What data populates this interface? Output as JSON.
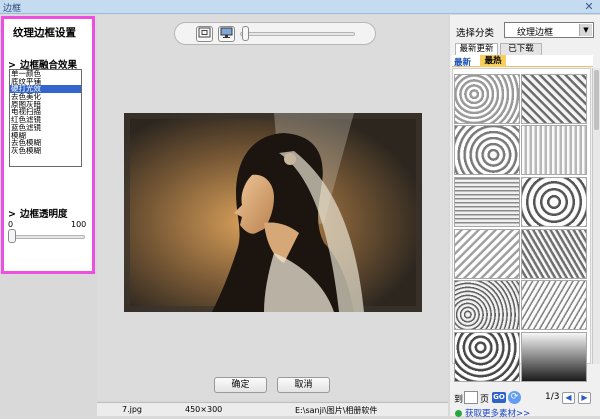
{
  "window": {
    "title": "边框",
    "close_glyph": "✕"
  },
  "left_panel": {
    "title": "纹理边框设置",
    "blend_section": {
      "title": "边框融合效果",
      "options": [
        "单一颜色",
        "底纹平铺",
        "硬打光效",
        "去色美化",
        "原图灰暗",
        "电视扫描",
        "红色滤镜",
        "蓝色滤镜",
        "模糊",
        "去色模糊",
        "灰色模糊"
      ],
      "selected_index": 2
    },
    "transparency_section": {
      "title": "边框透明度",
      "min_label": "0",
      "max_label": "100",
      "value": 0
    }
  },
  "preview": {
    "toolbar": {
      "fit_icon": "fit-to-window-icon",
      "actual_size_icon": "monitor-actual-size-icon",
      "zoom_level": 0
    },
    "confirm_label": "确定",
    "cancel_label": "取消",
    "status": {
      "filename": "7.jpg",
      "dimensions": "450×300",
      "path": "E:\\sanji\\图片\\相册软件"
    }
  },
  "right_panel": {
    "category_label": "选择分类",
    "category_value": "纹理边框",
    "tabs": [
      "最新更新",
      "已下载"
    ],
    "subtabs": [
      "最新",
      "最热"
    ],
    "active_subtab": 1,
    "thumbnails_count": 12,
    "pager": {
      "goto_label": "到",
      "page_label": "页",
      "go_label": "GO",
      "page_info": "1/3",
      "prev_glyph": "◀",
      "next_glyph": "▶"
    },
    "more_link": "获取更多素材>>"
  },
  "colors": {
    "panel_highlight": "#ee4fe0",
    "selection": "#3366cc",
    "active_subtab": "#f9cf5b",
    "link": "#1a44c9"
  }
}
